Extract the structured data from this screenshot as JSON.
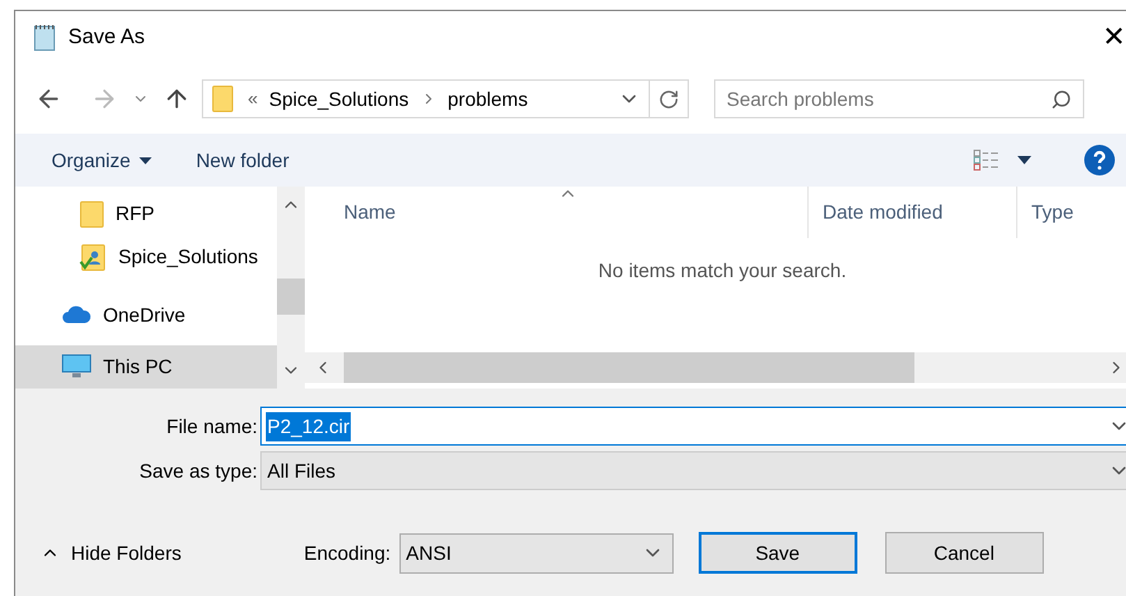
{
  "window": {
    "title": "Save As",
    "close": "✕"
  },
  "breadcrumb": {
    "overflow": "«",
    "parts": [
      "Spice_Solutions",
      "problems"
    ]
  },
  "search": {
    "placeholder": "Search problems"
  },
  "toolbar": {
    "organize": "Organize",
    "new_folder": "New folder"
  },
  "sidebar": {
    "items": [
      {
        "kind": "folder",
        "label": "RFP",
        "selected": false
      },
      {
        "kind": "user-folder",
        "label": "Spice_Solutions",
        "selected": false
      },
      {
        "kind": "cloud",
        "label": "OneDrive",
        "selected": false
      },
      {
        "kind": "computer",
        "label": "This PC",
        "selected": true
      }
    ]
  },
  "table": {
    "columns": [
      "Name",
      "Date modified",
      "Type"
    ],
    "empty_message": "No items match your search."
  },
  "form": {
    "file_name_label": "File name:",
    "file_name": "P2_12.cir",
    "type_label": "Save as type:",
    "type_value": "All Files",
    "encoding_label": "Encoding:",
    "encoding_value": "ANSI"
  },
  "hide_folders": "Hide Folders",
  "buttons": [
    {
      "label": "Save",
      "default": true
    },
    {
      "label": "Cancel",
      "default": false
    }
  ]
}
